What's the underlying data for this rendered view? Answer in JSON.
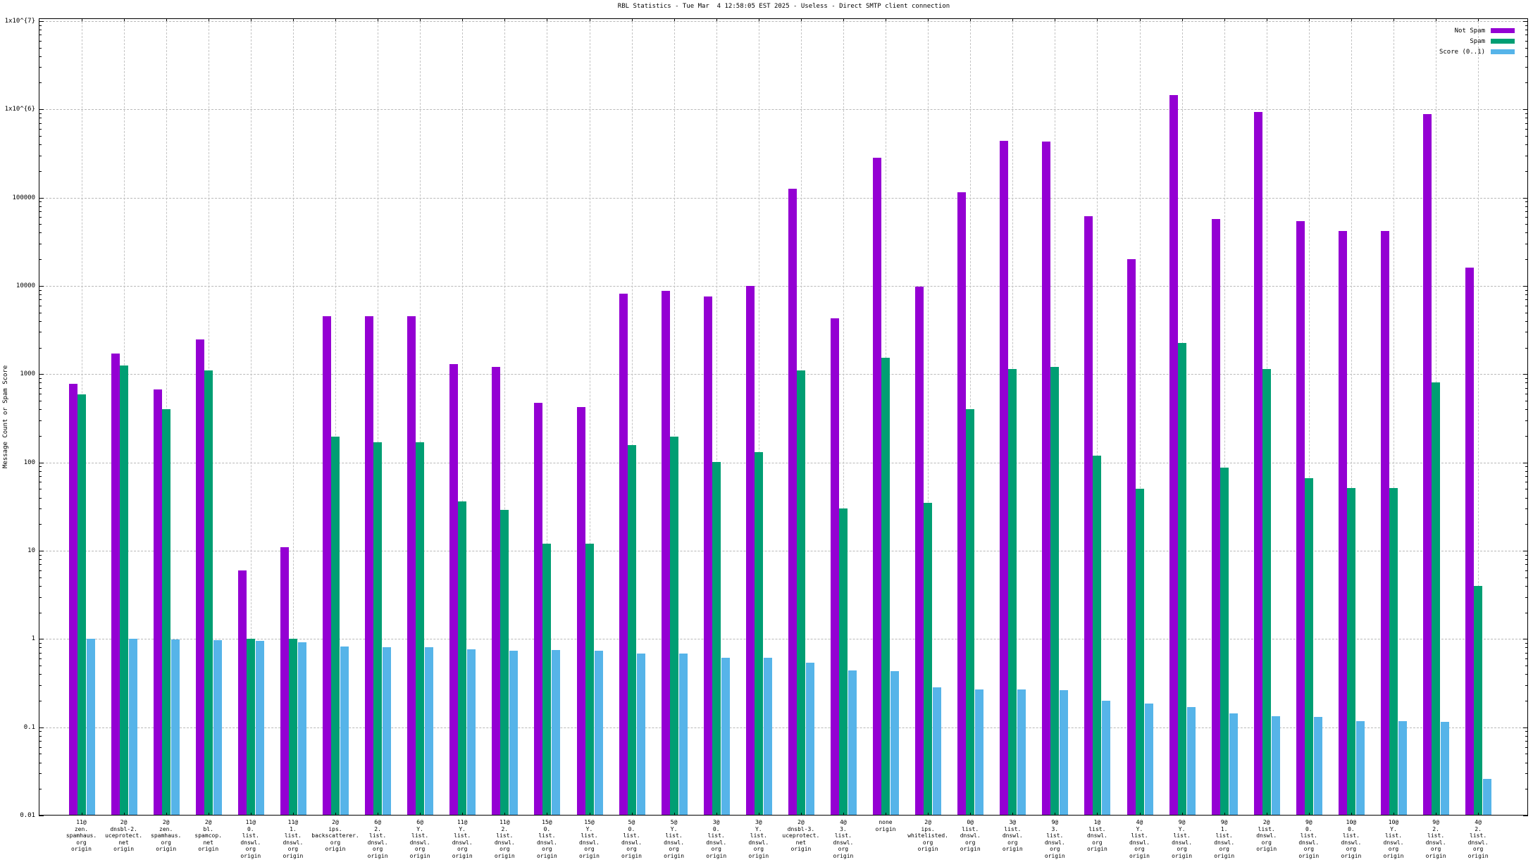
{
  "title": "RBL Statistics - Tue Mar  4 12:58:05 EST 2025 - Useless - Direct SMTP client connection",
  "y_axis_label": "Message Count or Spam Score",
  "legend": {
    "items": [
      {
        "label": "Not Spam",
        "color": "#9400d3"
      },
      {
        "label": "Spam",
        "color": "#009e73"
      },
      {
        "label": "Score (0..1)",
        "color": "#56b4e9"
      }
    ]
  },
  "chart_data": {
    "type": "bar",
    "title": "RBL Statistics - Tue Mar  4 12:58:05 EST 2025 - Useless - Direct SMTP client connection",
    "xlabel": "",
    "ylabel": "Message Count or Spam Score",
    "y_scale": "log",
    "ylim": [
      0.01,
      10000000
    ],
    "grid": true,
    "legend_position": "top-right-inside",
    "y_tick_labels": [
      "1x10^{7}",
      "1x10^{6}",
      "100000",
      "10000",
      "1000",
      "100",
      "10",
      "1",
      "0.1",
      "0.01"
    ],
    "y_tick_values": [
      10000000,
      1000000,
      100000,
      10000,
      1000,
      100,
      10,
      1,
      0.1,
      0.01
    ],
    "categories": [
      "11@\nzen.\nspamhaus.\norg\norigin",
      "2@\ndnsbl-2.\nuceprotect.\nnet\norigin",
      "2@\nzen.\nspamhaus.\norg\norigin",
      "2@\nbl.\nspamcop.\nnet\norigin",
      "11@\n0.\nlist.\ndnswl.\norg\norigin",
      "11@\n1.\nlist.\ndnswl.\norg\norigin",
      "2@\nips.\nbackscatterer.\norg\norigin",
      "6@\n2.\nlist.\ndnswl.\norg\norigin",
      "6@\nY.\nlist.\ndnswl.\norg\norigin",
      "11@\nY.\nlist.\ndnswl.\norg\norigin",
      "11@\n2.\nlist.\ndnswl.\norg\norigin",
      "15@\n0.\nlist.\ndnswl.\norg\norigin",
      "15@\nY.\nlist.\ndnswl.\norg\norigin",
      "5@\n0.\nlist.\ndnswl.\norg\norigin",
      "5@\nY.\nlist.\ndnswl.\norg\norigin",
      "3@\n0.\nlist.\ndnswl.\norg\norigin",
      "3@\nY.\nlist.\ndnswl.\norg\norigin",
      "2@\ndnsbl-3.\nuceprotect.\nnet\norigin",
      "4@\n3.\nlist.\ndnswl.\norg\norigin",
      "none\norigin",
      "2@\nips.\nwhitelisted.\norg\norigin",
      "0@\nlist.\ndnswl.\norg\norigin",
      "3@\nlist.\ndnswl.\norg\norigin",
      "9@\n3.\nlist.\ndnswl.\norg\norigin",
      "1@\nlist.\ndnswl.\norg\norigin",
      "4@\nY.\nlist.\ndnswl.\norg\norigin",
      "9@\nY.\nlist.\ndnswl.\norg\norigin",
      "9@\n1.\nlist.\ndnswl.\norg\norigin",
      "2@\nlist.\ndnswl.\norg\norigin",
      "9@\n0.\nlist.\ndnswl.\norg\norigin",
      "10@\n0.\nlist.\ndnswl.\norg\norigin",
      "10@\nY.\nlist.\ndnswl.\norg\norigin",
      "9@\n2.\nlist.\ndnswl.\norg\norigin",
      "4@\n2.\nlist.\ndnswl.\norg\norigin"
    ],
    "series": [
      {
        "name": "Not Spam",
        "color": "#9400d3",
        "values": [
          770,
          1700,
          670,
          2450,
          6,
          11,
          4500,
          4500,
          4500,
          1300,
          1200,
          470,
          420,
          8100,
          8800,
          7600,
          10000,
          125000,
          4300,
          285000,
          9800,
          115000,
          440000,
          430000,
          62000,
          20000,
          1450000,
          57000,
          930000,
          54000,
          42000,
          42000,
          890000,
          16000
        ]
      },
      {
        "name": "Spam",
        "color": "#009e73",
        "values": [
          590,
          1250,
          400,
          1100,
          1,
          1,
          195,
          170,
          170,
          36,
          29,
          12,
          12,
          156,
          195,
          102,
          131,
          1110,
          30,
          1520,
          35,
          400,
          1150,
          1200,
          120,
          50,
          2250,
          88,
          1150,
          66,
          51,
          51,
          810,
          4
        ]
      },
      {
        "name": "Score (0..1)",
        "color": "#56b4e9",
        "values": [
          1.0,
          1.0,
          0.98,
          0.97,
          0.95,
          0.91,
          0.82,
          0.8,
          0.8,
          0.77,
          0.74,
          0.75,
          0.74,
          0.68,
          0.68,
          0.61,
          0.61,
          0.54,
          0.44,
          0.43,
          0.285,
          0.27,
          0.27,
          0.265,
          0.2,
          0.185,
          0.17,
          0.143,
          0.133,
          0.13,
          0.118,
          0.118,
          0.116,
          0.026
        ]
      }
    ]
  }
}
